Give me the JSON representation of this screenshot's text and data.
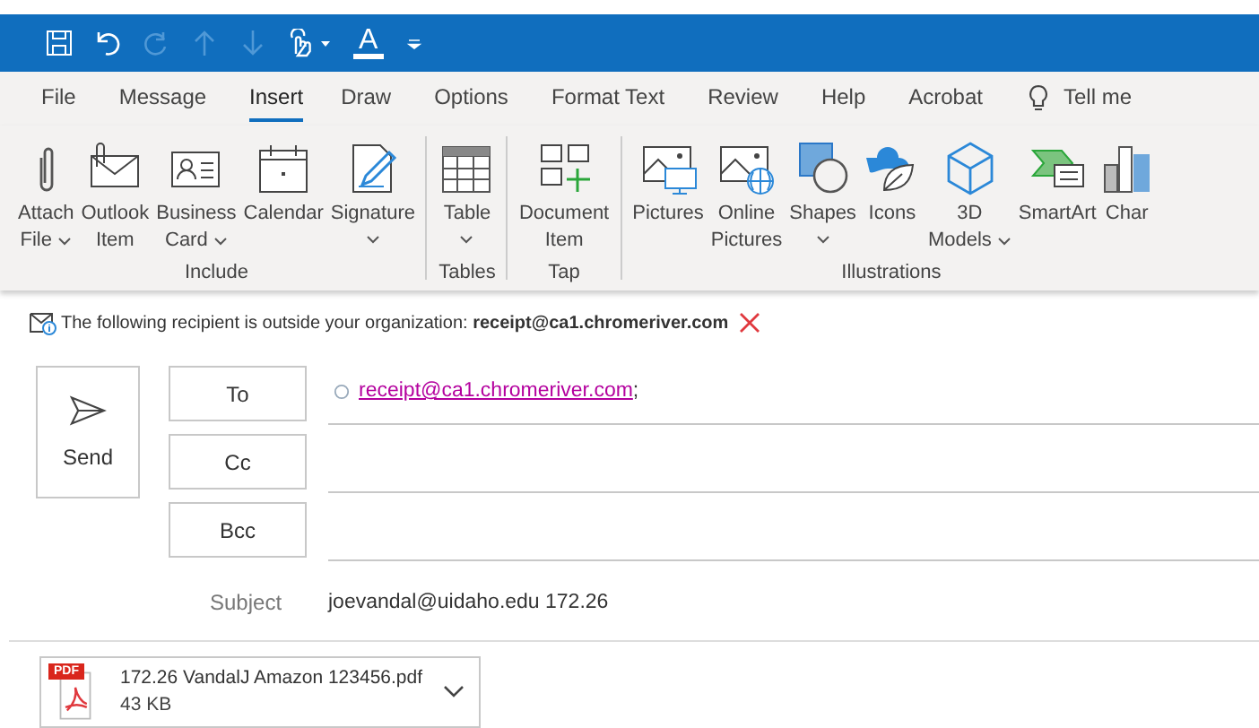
{
  "quick_access": [
    {
      "kind": "save",
      "disabled": false
    },
    {
      "kind": "undo",
      "disabled": false
    },
    {
      "kind": "redo",
      "disabled": true
    },
    {
      "kind": "up",
      "disabled": true
    },
    {
      "kind": "down",
      "disabled": true
    },
    {
      "kind": "touch",
      "disabled": false
    },
    {
      "kind": "font-color",
      "disabled": false,
      "text": "A"
    },
    {
      "kind": "customize",
      "disabled": false
    }
  ],
  "tabs": [
    {
      "label": "File",
      "selected": false
    },
    {
      "label": "Message",
      "selected": false
    },
    {
      "label": "Insert",
      "selected": true
    },
    {
      "label": "Draw",
      "selected": false
    },
    {
      "label": "Options",
      "selected": false
    },
    {
      "label": "Format Text",
      "selected": false
    },
    {
      "label": "Review",
      "selected": false
    },
    {
      "label": "Help",
      "selected": false
    },
    {
      "label": "Acrobat",
      "selected": false
    }
  ],
  "tell_me": "Tell me",
  "ribbon_groups": [
    {
      "label": "Include",
      "buttons": [
        {
          "lines": [
            "Attach",
            "File"
          ],
          "dropdown": true
        },
        {
          "lines": [
            "Outlook",
            "Item"
          ],
          "dropdown": false
        },
        {
          "lines": [
            "Business",
            "Card"
          ],
          "dropdown": true
        },
        {
          "lines": [
            "Calendar"
          ],
          "dropdown": false
        },
        {
          "lines": [
            "Signature"
          ],
          "dropdown": true
        }
      ]
    },
    {
      "label": "Tables",
      "buttons": [
        {
          "lines": [
            "Table"
          ],
          "dropdown": true
        }
      ]
    },
    {
      "label": "Tap",
      "buttons": [
        {
          "lines": [
            "Document",
            "Item"
          ],
          "dropdown": false
        }
      ]
    },
    {
      "label": "Illustrations",
      "buttons": [
        {
          "lines": [
            "Pictures"
          ],
          "dropdown": false
        },
        {
          "lines": [
            "Online",
            "Pictures"
          ],
          "dropdown": false
        },
        {
          "lines": [
            "Shapes"
          ],
          "dropdown": true
        },
        {
          "lines": [
            "Icons"
          ],
          "dropdown": false
        },
        {
          "lines": [
            "3D",
            "Models"
          ],
          "dropdown": true
        },
        {
          "lines": [
            "SmartArt"
          ],
          "dropdown": false
        },
        {
          "lines": [
            "Char"
          ],
          "dropdown": false
        }
      ]
    }
  ],
  "warning": {
    "text": "The following recipient is outside your organization: **receipt@ca1.chromeriver.com**"
  },
  "send_button": "Send",
  "fields": [
    {
      "button": "To",
      "recipients": [
        {
          "address": "receipt@ca1.chromeriver.com",
          "separator": ";"
        }
      ]
    },
    {
      "button": "Cc"
    },
    {
      "button": "Bcc"
    }
  ],
  "subject": {
    "label": "Subject",
    "value": "joevandal@uidaho.edu 172.26"
  },
  "attachment": {
    "name": "172.26 VandalJ Amazon 123456.pdf",
    "size": "43 KB",
    "badge": "PDF"
  }
}
